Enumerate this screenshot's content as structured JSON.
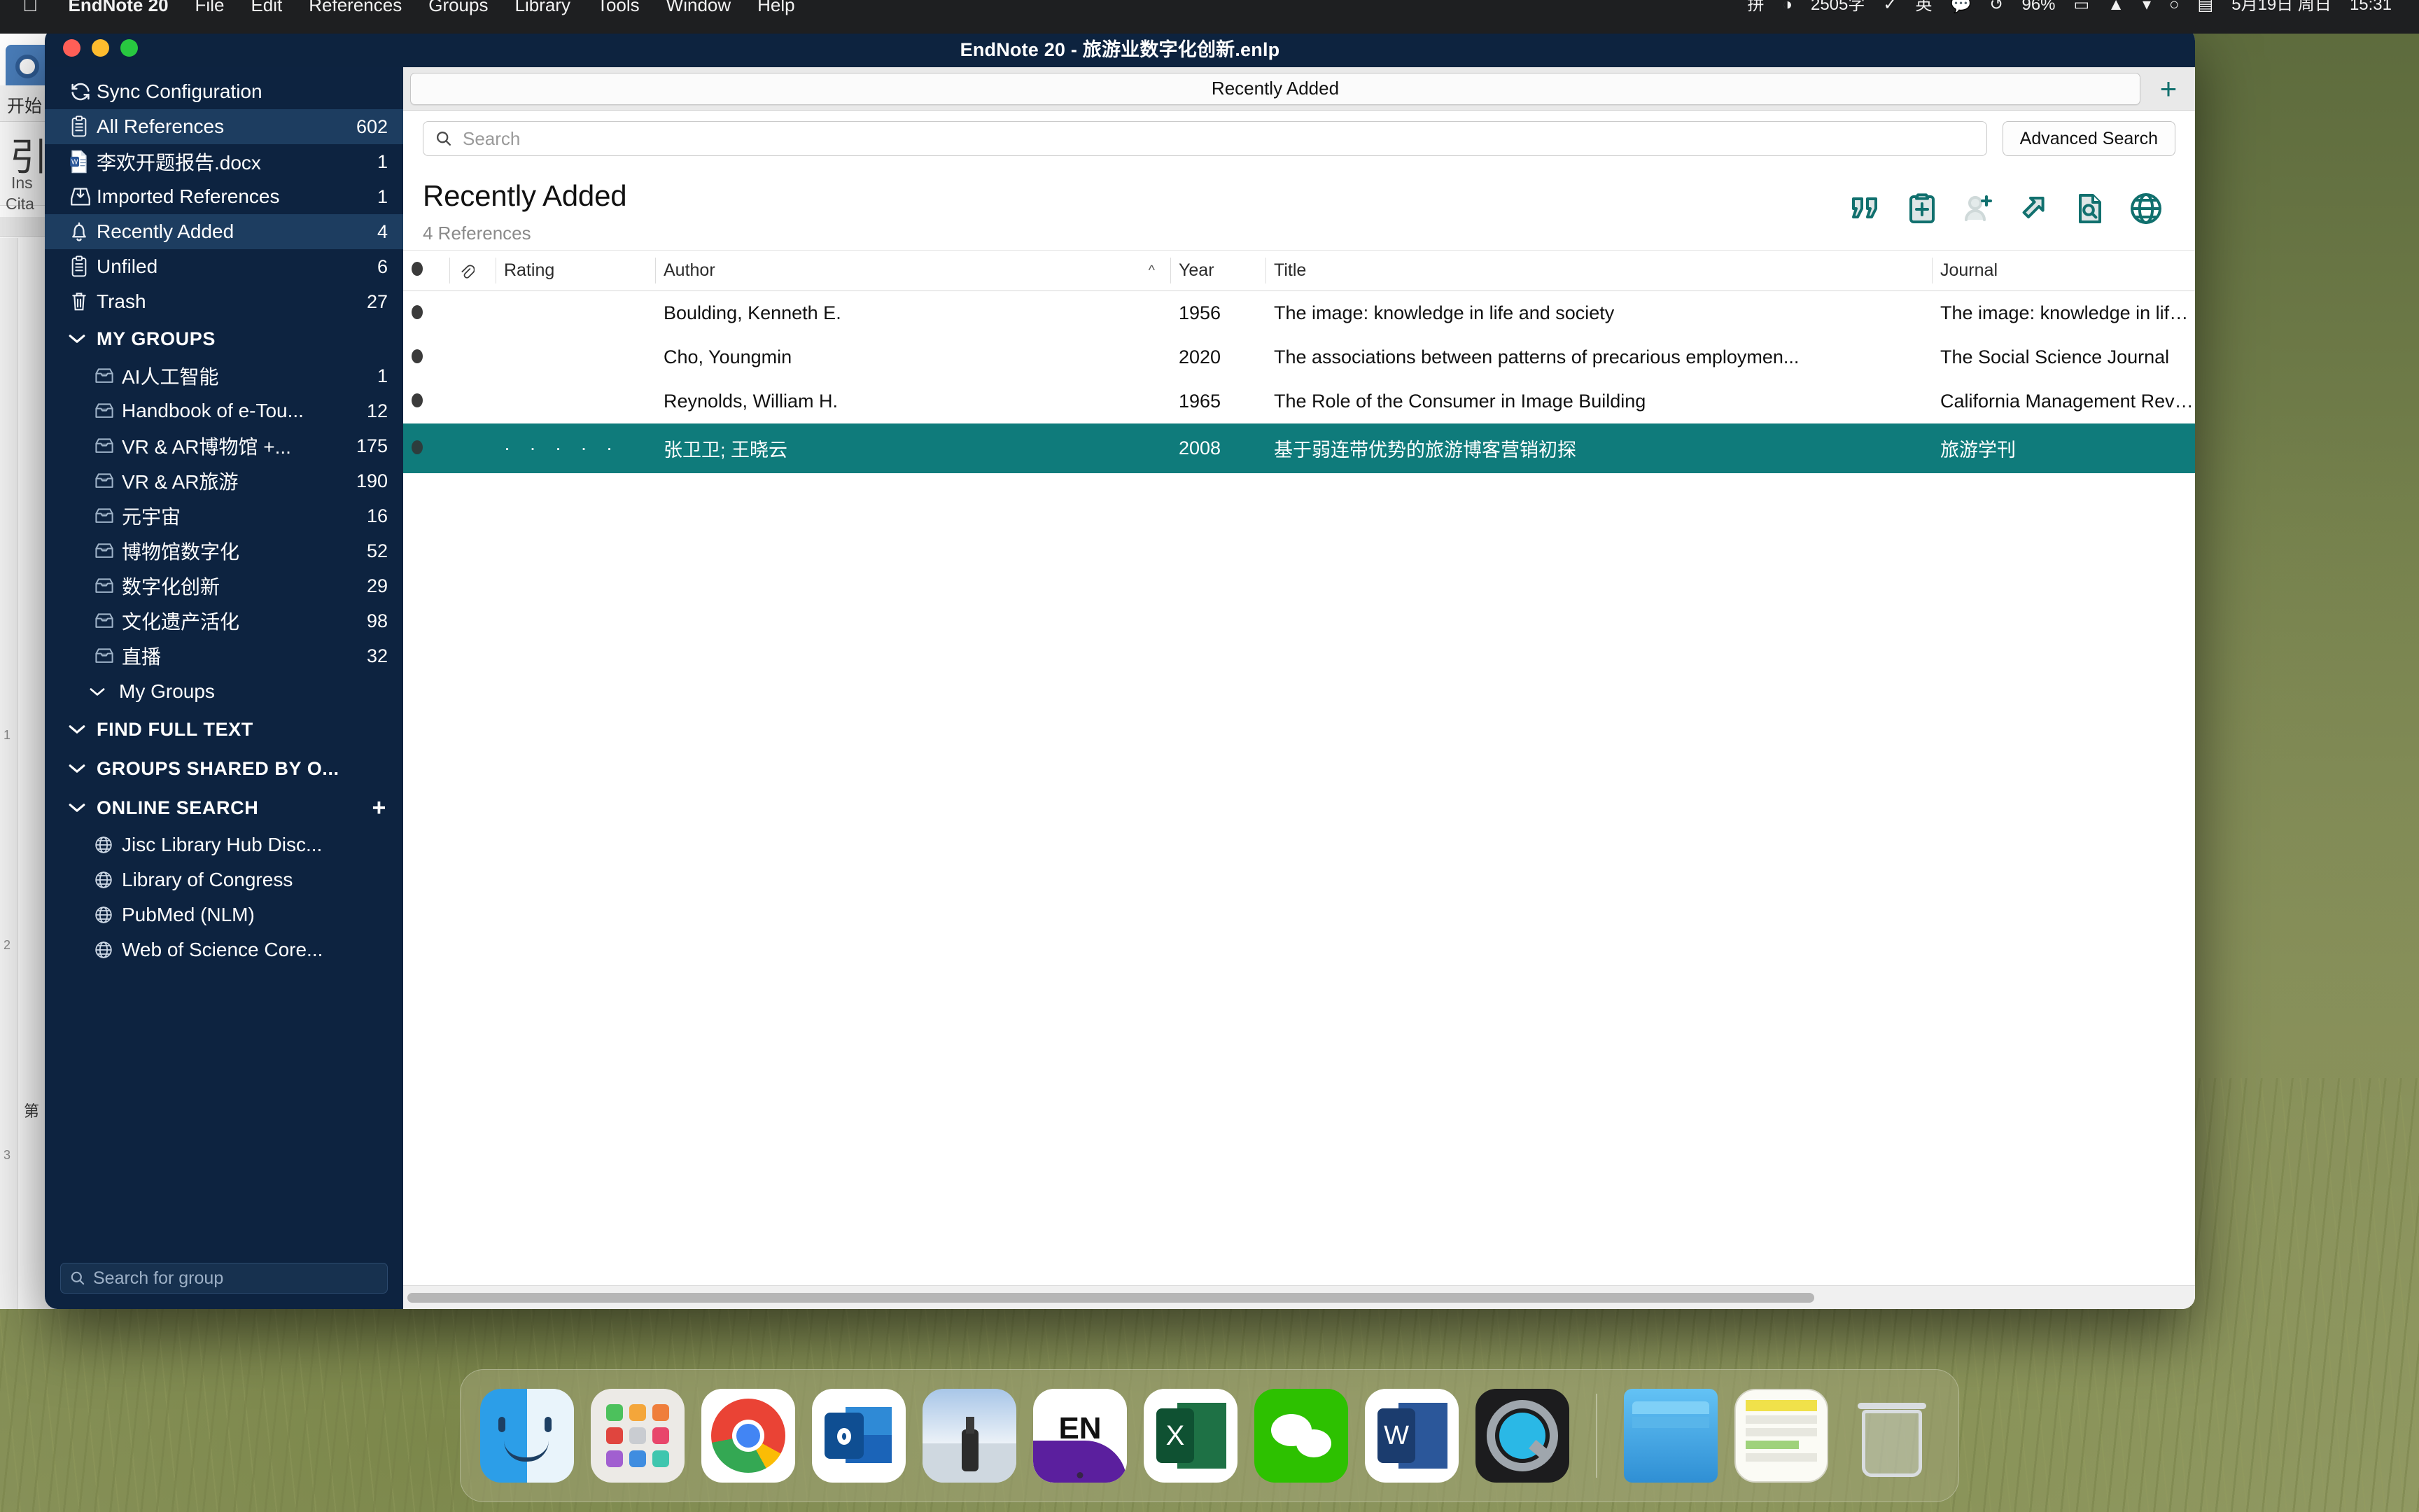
{
  "menubar": {
    "apple": "",
    "items": [
      {
        "label": "EndNote 20",
        "bold": true
      },
      {
        "label": "File",
        "bold": false
      },
      {
        "label": "Edit",
        "bold": false
      },
      {
        "label": "References",
        "bold": false
      },
      {
        "label": "Groups",
        "bold": false
      },
      {
        "label": "Library",
        "bold": false
      },
      {
        "label": "Tools",
        "bold": false
      },
      {
        "label": "Window",
        "bold": false
      },
      {
        "label": "Help",
        "bold": false
      }
    ],
    "status": [
      {
        "name": "input-source-icon",
        "glyph": "拼"
      },
      {
        "name": "shield-icon",
        "glyph": "◑"
      },
      {
        "name": "word-count-status",
        "glyph": "2505字"
      },
      {
        "name": "checkmark-circle-icon",
        "glyph": "✓"
      },
      {
        "name": "ime-chinese-icon",
        "glyph": "英"
      },
      {
        "name": "speech-bubble-icon",
        "glyph": "💬"
      },
      {
        "name": "refresh-icon",
        "glyph": "↺"
      },
      {
        "name": "battery-percent",
        "glyph": "96%"
      },
      {
        "name": "battery-icon",
        "glyph": "▭"
      },
      {
        "name": "dropbox-icon",
        "glyph": "▲"
      },
      {
        "name": "wifi-icon",
        "glyph": "▾"
      },
      {
        "name": "spotlight-search-icon",
        "glyph": "○"
      },
      {
        "name": "control-center-icon",
        "glyph": "▤"
      },
      {
        "name": "date-display",
        "glyph": "5月19日 周日"
      },
      {
        "name": "clock-display",
        "glyph": "15:31"
      }
    ]
  },
  "background_document": {
    "tab_label": "开始",
    "big_glyph": "引",
    "insert_line1": "Ins",
    "insert_line2": "Cita",
    "ruler_marks": [
      "1",
      "2",
      "3"
    ],
    "side_char": "第"
  },
  "window": {
    "title": "EndNote 20 - 旅游业数字化创新.enlp"
  },
  "sidebar": {
    "sync": {
      "label": "Sync Configuration",
      "icon": "sync-icon"
    },
    "library_items": [
      {
        "label": "All References",
        "count": "602",
        "icon": "clipboard-icon",
        "selected": true
      },
      {
        "label": "李欢开题报告.docx",
        "count": "1",
        "icon": "word-document-icon",
        "selected": false
      },
      {
        "label": "Imported References",
        "count": "1",
        "icon": "import-tray-icon",
        "selected": false
      },
      {
        "label": "Recently Added",
        "count": "4",
        "icon": "bell-icon",
        "selected": true
      },
      {
        "label": "Unfiled",
        "count": "6",
        "icon": "clipboard-icon",
        "selected": false
      },
      {
        "label": "Trash",
        "count": "27",
        "icon": "trash-icon",
        "selected": false
      }
    ],
    "my_groups_header": "MY GROUPS",
    "groups": [
      {
        "label": "AI人工智能",
        "count": "1"
      },
      {
        "label": "Handbook of e-Tou...",
        "count": "12"
      },
      {
        "label": "VR & AR博物馆 +...",
        "count": "175"
      },
      {
        "label": "VR & AR旅游",
        "count": "190"
      },
      {
        "label": "元宇宙",
        "count": "16"
      },
      {
        "label": "博物馆数字化",
        "count": "52"
      },
      {
        "label": "数字化创新",
        "count": "29"
      },
      {
        "label": "文化遗产活化",
        "count": "98"
      },
      {
        "label": "直播",
        "count": "32"
      }
    ],
    "my_groups_sub": "My Groups",
    "find_full_text_header": "FIND FULL TEXT",
    "groups_shared_header": "GROUPS SHARED BY O...",
    "online_search_header": "ONLINE SEARCH",
    "online_search_add": "+",
    "online_sources": [
      {
        "label": "Jisc Library Hub Disc..."
      },
      {
        "label": "Library of Congress"
      },
      {
        "label": "PubMed (NLM)"
      },
      {
        "label": "Web of Science Core..."
      }
    ],
    "group_search_placeholder": "Search for group"
  },
  "main": {
    "tab_label": "Recently Added",
    "tab_add": "+",
    "search_placeholder": "Search",
    "advanced_search_label": "Advanced Search",
    "list_title": "Recently Added",
    "list_count": "4 References",
    "toolbar_icons": [
      {
        "name": "insert-citation-icon"
      },
      {
        "name": "copy-to-clipboard-icon"
      },
      {
        "name": "add-person-icon"
      },
      {
        "name": "open-external-icon"
      },
      {
        "name": "find-full-text-icon"
      },
      {
        "name": "online-search-icon"
      }
    ],
    "columns": [
      {
        "key": "read",
        "label": ""
      },
      {
        "key": "attach",
        "label": ""
      },
      {
        "key": "rating",
        "label": "Rating"
      },
      {
        "key": "author",
        "label": "Author",
        "sorted": "asc"
      },
      {
        "key": "year",
        "label": "Year"
      },
      {
        "key": "title",
        "label": "Title"
      },
      {
        "key": "journal",
        "label": "Journal"
      }
    ],
    "rows": [
      {
        "rating": "",
        "author": "Boulding, Kenneth E.",
        "year": "1956",
        "title": "The image: knowledge in life and society",
        "journal": "The image: knowledge in life and society.",
        "selected": false
      },
      {
        "rating": "",
        "author": "Cho, Youngmin",
        "year": "2020",
        "title": "The associations between patterns of precarious employmen...",
        "journal": "The Social Science Journal",
        "selected": false
      },
      {
        "rating": "",
        "author": "Reynolds, William H.",
        "year": "1965",
        "title": "The Role of the Consumer in Image Building",
        "journal": "California Management Review",
        "selected": false
      },
      {
        "rating": "· · · · ·",
        "author": "张卫卫; 王晓云",
        "year": "2008",
        "title": "基于弱连带优势的旅游博客营销初探",
        "journal": "旅游学刊",
        "selected": true
      }
    ]
  },
  "dock": {
    "items": [
      {
        "name": "finder-icon",
        "label": "Finder"
      },
      {
        "name": "launchpad-icon",
        "label": "Launchpad"
      },
      {
        "name": "chrome-icon",
        "label": "Google Chrome"
      },
      {
        "name": "outlook-icon",
        "label": "Outlook"
      },
      {
        "name": "preview-icon",
        "label": "Preview"
      },
      {
        "name": "endnote-icon",
        "label": "EndNote"
      },
      {
        "name": "excel-icon",
        "label": "Excel"
      },
      {
        "name": "wechat-icon",
        "label": "WeChat"
      },
      {
        "name": "word-icon",
        "label": "Word"
      },
      {
        "name": "quicktime-icon",
        "label": "QuickTime"
      },
      {
        "name": "downloads-folder-icon",
        "label": "Downloads"
      },
      {
        "name": "document-stack-icon",
        "label": "Documents"
      },
      {
        "name": "trash-icon",
        "label": "Trash"
      }
    ]
  },
  "colors": {
    "sidebar_bg": "#0d2340",
    "sidebar_selected": "#1d3d60",
    "titlebar_bg": "#0d233f",
    "accent_teal": "#0f7b7b",
    "toolbar_icon": "#11706e"
  }
}
